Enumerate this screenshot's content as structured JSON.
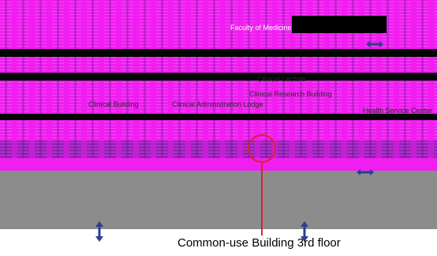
{
  "map": {
    "labels": {
      "faculty_of_medicine": "Faculty of Medicine",
      "clinical_building": "Clinical Building",
      "clinical_administration": "Clinical Administration Lodge",
      "clinical_research_building": "Clinical Research Building",
      "clinical_lecture": "Clinical Lecture",
      "health_service_center": "Health Service Center"
    },
    "caption": "Common-use Building 3rd floor",
    "colors": {
      "marker": "#e0202a",
      "arrow": "#2b3f8f",
      "glitch_magenta": "#f01ef0"
    },
    "icons": [
      "vertical-arrow-icon",
      "horizontal-arrow-icon",
      "location-pin-icon"
    ]
  }
}
